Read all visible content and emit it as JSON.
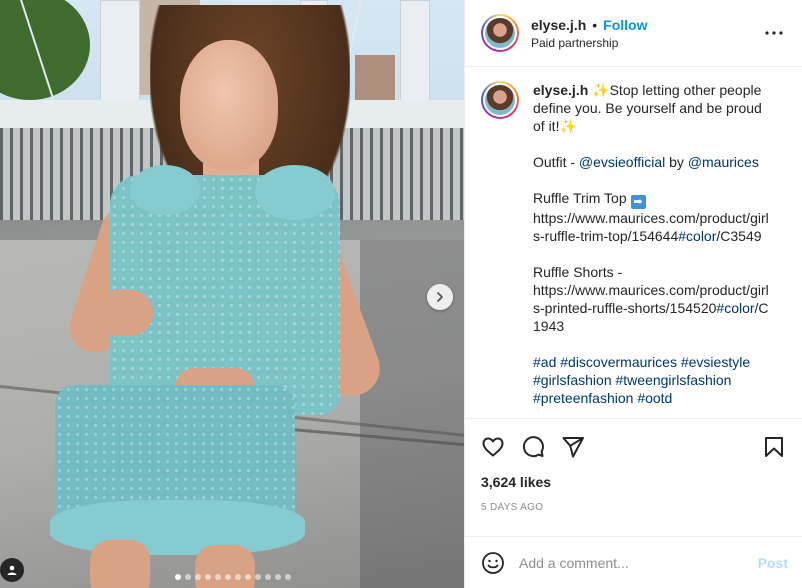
{
  "post": {
    "username": "elyse.j.h",
    "separator": "•",
    "follow_label": "Follow",
    "partnership": "Paid partnership",
    "more_icon": "more-options-icon",
    "carousel": {
      "total_slides": 12,
      "active_index": 0
    }
  },
  "caption": {
    "username": "elyse.j.h",
    "line1": "Stop letting other people define you. Be yourself and be proud of it!",
    "outfit_label": "Outfit - ",
    "mention1": "@evsieofficial",
    "by": " by ",
    "mention2": "@maurices",
    "top_label": "Ruffle Trim Top ",
    "top_arrow": "➡",
    "top_url_a": "https://www.maurices.com/product/girls-ruffle-trim-top/154644",
    "top_url_tag": "#color",
    "top_url_b": "/C3549",
    "shorts_label": "Ruffle Shorts - ",
    "shorts_url_a": "https://www.maurices.com/product/girls-printed-ruffle-shorts/154520",
    "shorts_url_tag": "#color",
    "shorts_url_b": "/C1943",
    "hashtags": [
      "#ad",
      "#discovermaurices",
      "#evsiestyle",
      "#girlsfashion",
      "#tweengirlsfashion",
      "#preteenfashion",
      "#ootd"
    ]
  },
  "stats": {
    "likes": "3,624 likes",
    "time_ago": "5 DAYS AGO"
  },
  "comment": {
    "placeholder": "Add a comment...",
    "post_label": "Post"
  },
  "colors": {
    "accent": "#0095f6",
    "link": "#00376b",
    "muted": "#8e8e8e",
    "post_disabled": "#b2dffc"
  }
}
